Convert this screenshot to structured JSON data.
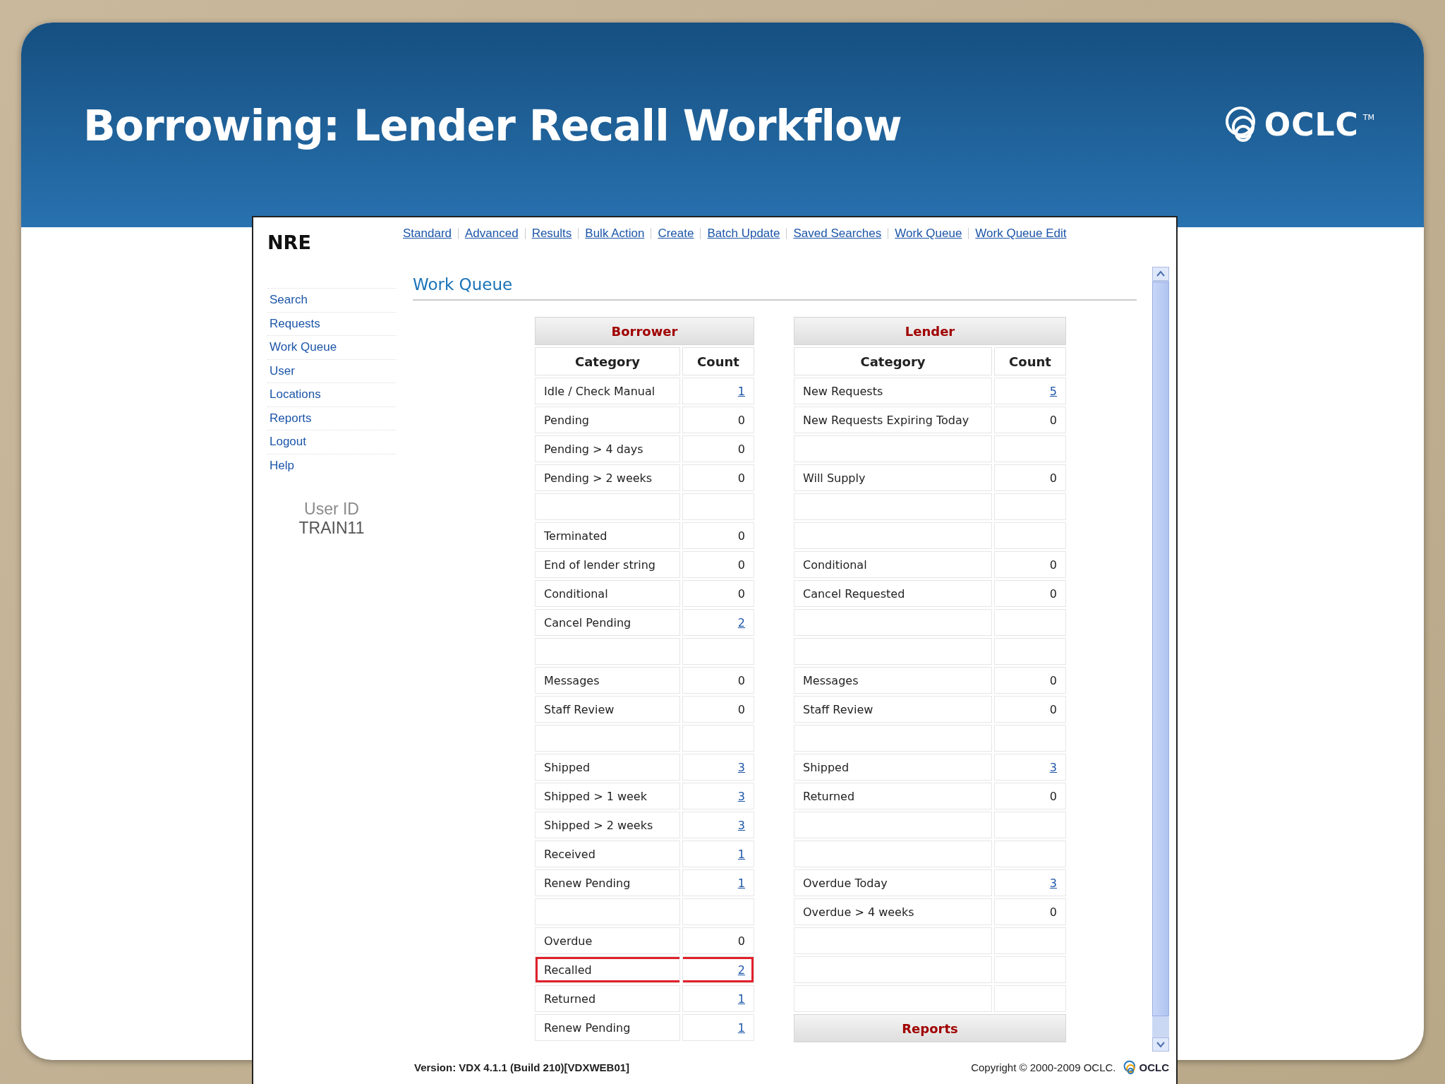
{
  "slide": {
    "title": "Borrowing: Lender Recall Workflow",
    "logo": {
      "text": "OCLC",
      "mark": "TM"
    }
  },
  "app": {
    "brand": "NRE",
    "nav": [
      "Standard",
      "Advanced",
      "Results",
      "Bulk Action",
      "Create",
      "Batch Update",
      "Saved Searches",
      "Work Queue",
      "Work Queue Edit"
    ],
    "sidebar": {
      "items": [
        "Search",
        "Requests",
        "Work Queue",
        "User",
        "Locations",
        "Reports",
        "Logout",
        "Help"
      ],
      "user_label": "User ID",
      "user_id": "TRAIN11"
    },
    "heading": "Work Queue",
    "tables": [
      {
        "title": "Borrower",
        "columns": [
          "Category",
          "Count"
        ],
        "rows": [
          {
            "kind": "data",
            "category": "Idle / Check Manual",
            "count": "1",
            "linked": true,
            "highlighted": false
          },
          {
            "kind": "data",
            "category": "Pending",
            "count": "0",
            "linked": false,
            "highlighted": false
          },
          {
            "kind": "data",
            "category": "Pending > 4 days",
            "count": "0",
            "linked": false,
            "highlighted": false
          },
          {
            "kind": "data",
            "category": "Pending > 2 weeks",
            "count": "0",
            "linked": false,
            "highlighted": false
          },
          {
            "kind": "blank"
          },
          {
            "kind": "data",
            "category": "Terminated",
            "count": "0",
            "linked": false,
            "highlighted": false
          },
          {
            "kind": "data",
            "category": "End of lender string",
            "count": "0",
            "linked": false,
            "highlighted": false
          },
          {
            "kind": "data",
            "category": "Conditional",
            "count": "0",
            "linked": false,
            "highlighted": false
          },
          {
            "kind": "data",
            "category": "Cancel Pending",
            "count": "2",
            "linked": true,
            "highlighted": false
          },
          {
            "kind": "blank"
          },
          {
            "kind": "data",
            "category": "Messages",
            "count": "0",
            "linked": false,
            "highlighted": false
          },
          {
            "kind": "data",
            "category": "Staff Review",
            "count": "0",
            "linked": false,
            "highlighted": false
          },
          {
            "kind": "blank"
          },
          {
            "kind": "data",
            "category": "Shipped",
            "count": "3",
            "linked": true,
            "highlighted": false
          },
          {
            "kind": "data",
            "category": "Shipped > 1 week",
            "count": "3",
            "linked": true,
            "highlighted": false
          },
          {
            "kind": "data",
            "category": "Shipped > 2 weeks",
            "count": "3",
            "linked": true,
            "highlighted": false
          },
          {
            "kind": "data",
            "category": "Received",
            "count": "1",
            "linked": true,
            "highlighted": false
          },
          {
            "kind": "data",
            "category": "Renew Pending",
            "count": "1",
            "linked": true,
            "highlighted": false
          },
          {
            "kind": "blank"
          },
          {
            "kind": "data",
            "category": "Overdue",
            "count": "0",
            "linked": false,
            "highlighted": false
          },
          {
            "kind": "data",
            "category": "Recalled",
            "count": "2",
            "linked": true,
            "highlighted": true
          },
          {
            "kind": "data",
            "category": "Returned",
            "count": "1",
            "linked": true,
            "highlighted": false
          },
          {
            "kind": "data",
            "category": "Renew Pending",
            "count": "1",
            "linked": true,
            "highlighted": false
          }
        ]
      },
      {
        "title": "Lender",
        "columns": [
          "Category",
          "Count"
        ],
        "rows": [
          {
            "kind": "data",
            "category": "New Requests",
            "count": "5",
            "linked": true,
            "highlighted": false
          },
          {
            "kind": "data",
            "category": "New Requests Expiring Today",
            "count": "0",
            "linked": false,
            "highlighted": false
          },
          {
            "kind": "blank"
          },
          {
            "kind": "data",
            "category": "Will Supply",
            "count": "0",
            "linked": false,
            "highlighted": false
          },
          {
            "kind": "blank"
          },
          {
            "kind": "blank"
          },
          {
            "kind": "data",
            "category": "Conditional",
            "count": "0",
            "linked": false,
            "highlighted": false
          },
          {
            "kind": "data",
            "category": "Cancel Requested",
            "count": "0",
            "linked": false,
            "highlighted": false
          },
          {
            "kind": "blank"
          },
          {
            "kind": "blank"
          },
          {
            "kind": "data",
            "category": "Messages",
            "count": "0",
            "linked": false,
            "highlighted": false
          },
          {
            "kind": "data",
            "category": "Staff Review",
            "count": "0",
            "linked": false,
            "highlighted": false
          },
          {
            "kind": "blank"
          },
          {
            "kind": "data",
            "category": "Shipped",
            "count": "3",
            "linked": true,
            "highlighted": false
          },
          {
            "kind": "data",
            "category": "Returned",
            "count": "0",
            "linked": false,
            "highlighted": false
          },
          {
            "kind": "blank"
          },
          {
            "kind": "blank"
          },
          {
            "kind": "data",
            "category": "Overdue Today",
            "count": "3",
            "linked": true,
            "highlighted": false
          },
          {
            "kind": "data",
            "category": "Overdue > 4 weeks",
            "count": "0",
            "linked": false,
            "highlighted": false
          },
          {
            "kind": "blank"
          },
          {
            "kind": "blank"
          },
          {
            "kind": "blank"
          },
          {
            "kind": "section",
            "title": "Reports"
          }
        ]
      }
    ],
    "footer": {
      "version": "Version: VDX 4.1.1 (Build 210)[VDXWEB01]",
      "copyright": "Copyright © 2000-2009 OCLC.",
      "logo_text": "OCLC"
    }
  }
}
